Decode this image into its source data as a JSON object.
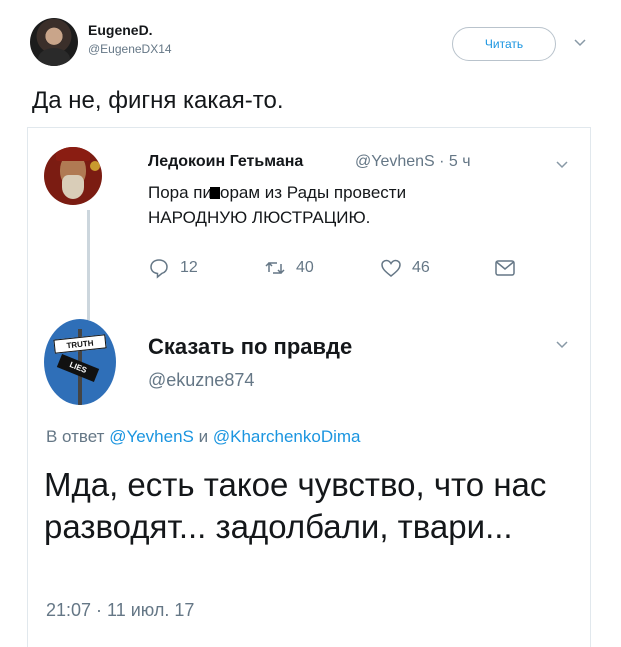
{
  "outer_tweet": {
    "display_name": "EugeneD.",
    "handle": "@EugeneDX14",
    "follow_label": "Читать",
    "text": "Да не, фигня какая-то."
  },
  "quoted_tweet": {
    "display_name": "Ледокоин Гетьмана",
    "meta": "@YevhenS · 5 ч",
    "text_line1_a": "Пора пи",
    "text_line1_b": "орам из Рады провести",
    "text_line2": "НАРОДНУЮ ЛЮСТРАЦИЮ.",
    "actions": {
      "reply_count": "12",
      "retweet_count": "40",
      "like_count": "46"
    }
  },
  "reply_tweet": {
    "display_name": "Сказать по правде",
    "handle": "@ekuzne874",
    "avatar_sign_top": "TRUTH",
    "avatar_sign_bottom": "LIES",
    "reply_prefix": "В ответ",
    "reply_user1": "@YevhenS",
    "reply_and": "и",
    "reply_user2": "@KharchenkoDima",
    "text": "Мда, есть такое чувство, что нас разводят... задолбали, твари...",
    "timestamp": "21:07 · 11 июл. 17"
  },
  "colors": {
    "link": "#1b95e0",
    "secondary_text": "#657786",
    "border": "#e1e8ed"
  }
}
